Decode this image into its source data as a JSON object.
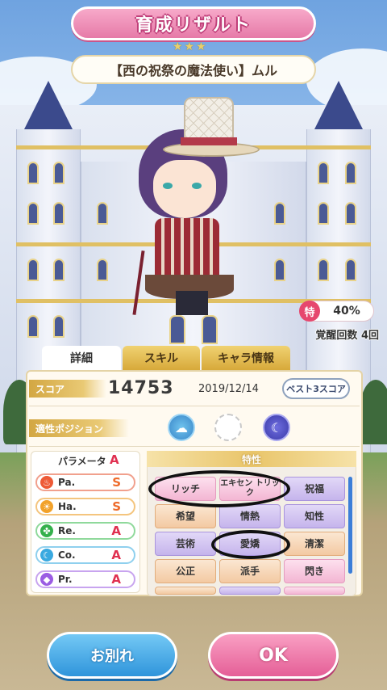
{
  "header": {
    "title": "育成リザルト",
    "subtitle_stars": "★★★"
  },
  "character": {
    "name": "【西の祝祭の魔法使い】ムル"
  },
  "awakening": {
    "badge": "特",
    "percent": "40%",
    "count_label": "覚醒回数 4回"
  },
  "tabs": [
    {
      "label": "詳細",
      "active": true
    },
    {
      "label": "スキル",
      "active": false
    },
    {
      "label": "キャラ情報",
      "active": false
    }
  ],
  "score": {
    "label": "スコア",
    "value": "14753",
    "date": "2019/12/14",
    "best_button": "ベスト3スコア"
  },
  "position": {
    "label": "適性ポジション"
  },
  "params": {
    "header": "パラメータ",
    "header_grade": "A",
    "items": [
      {
        "name": "Pa.",
        "grade": "S",
        "icon": "flame-icon"
      },
      {
        "name": "Ha.",
        "grade": "S",
        "icon": "sun-icon"
      },
      {
        "name": "Re.",
        "grade": "A",
        "icon": "clover-icon"
      },
      {
        "name": "Co.",
        "grade": "A",
        "icon": "moon-icon"
      },
      {
        "name": "Pr.",
        "grade": "A",
        "icon": "gem-icon"
      }
    ]
  },
  "traits": {
    "header": "特性",
    "items": [
      "リッチ",
      "エキセン トリック",
      "祝福",
      "希望",
      "情熱",
      "知性",
      "芸術",
      "愛嬌",
      "清潔",
      "公正",
      "派手",
      "閃き"
    ]
  },
  "buttons": {
    "farewell": "お別れ",
    "ok": "OK"
  },
  "colors": {
    "accent_pink": "#e67aa8",
    "accent_gold": "#d7a93a",
    "blue_button": "#2f95db"
  }
}
